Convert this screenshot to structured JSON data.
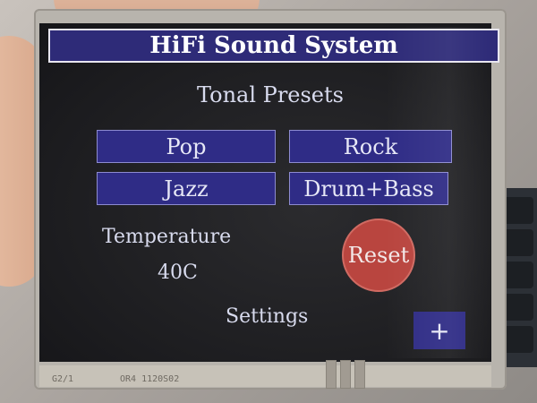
{
  "app": {
    "title": "HiFi Sound System"
  },
  "presets": {
    "heading": "Tonal Presets",
    "buttons": [
      {
        "label": "Pop"
      },
      {
        "label": "Rock"
      },
      {
        "label": "Jazz"
      },
      {
        "label": "Drum+Bass"
      }
    ]
  },
  "temperature": {
    "label": "Temperature",
    "value": "40C"
  },
  "controls": {
    "reset_label": "Reset",
    "settings_label": "Settings",
    "plus_label": "+"
  },
  "device": {
    "marking_left": "G2/1",
    "marking_right": "OR4 1120S02"
  },
  "colors": {
    "button_fill": "#2f2c86",
    "title_fill": "#2e2b78",
    "reset_fill": "#b9453f",
    "screen_bg": "#1c1c1f",
    "text": "#d8dbee"
  }
}
